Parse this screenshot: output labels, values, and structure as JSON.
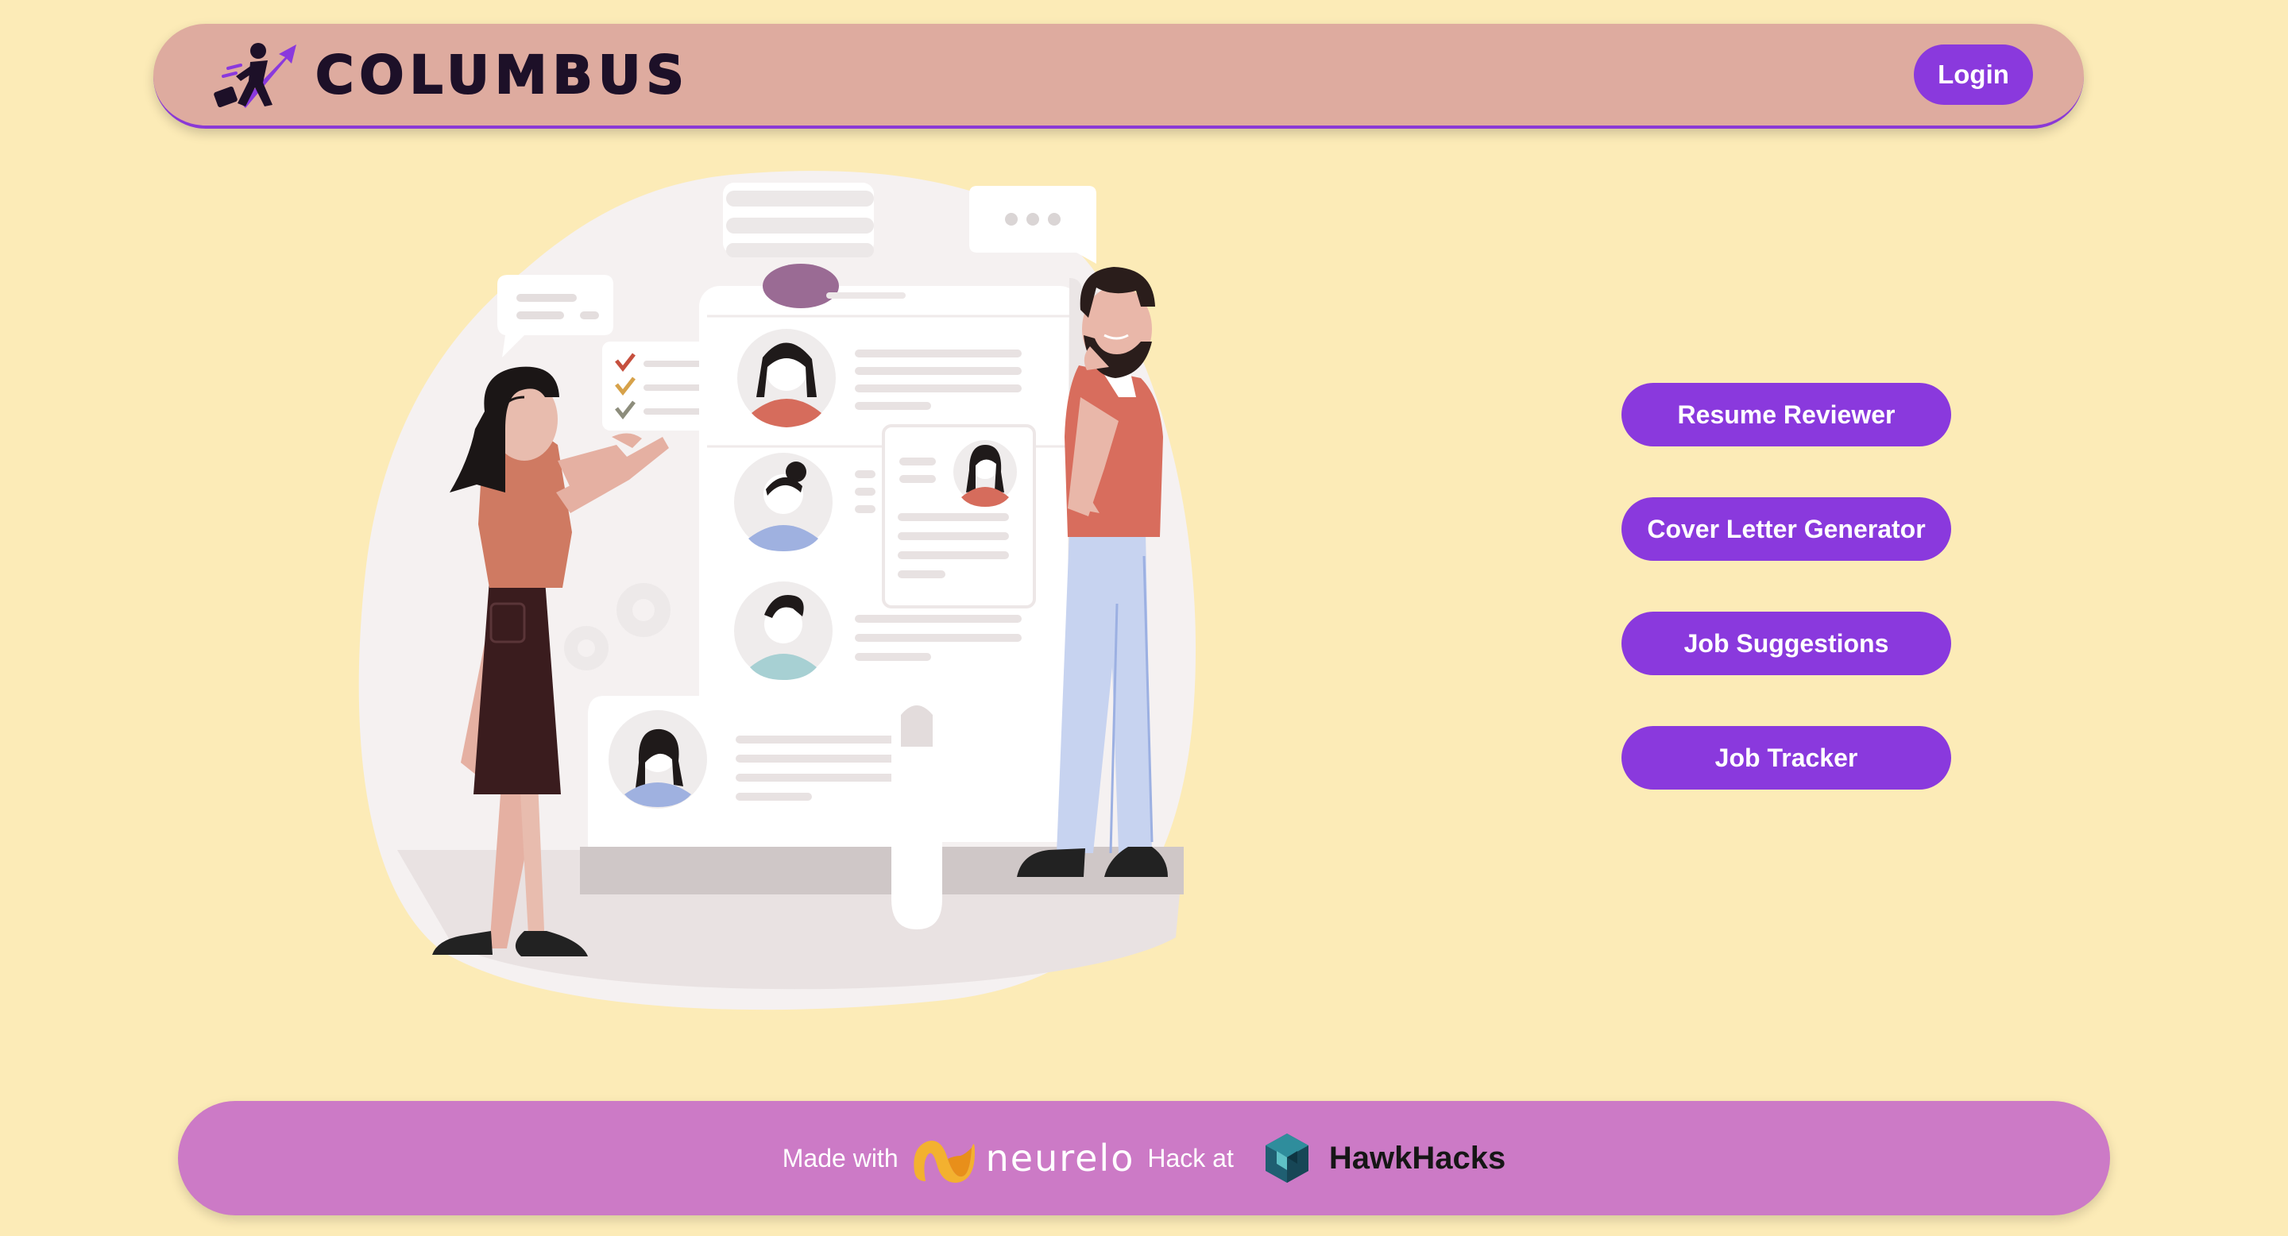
{
  "header": {
    "brand_name": "COLUMBUS",
    "login_label": "Login"
  },
  "hero": {
    "illustration": "recruiting-illustration"
  },
  "actions": [
    {
      "label": "Resume Reviewer"
    },
    {
      "label": "Cover Letter Generator"
    },
    {
      "label": "Job Suggestions"
    },
    {
      "label": "Job Tracker"
    }
  ],
  "footer": {
    "made_with": "Made with",
    "neurelo_name": "neurelo",
    "hack_at": "Hack at",
    "hawkhacks_name": "HawkHacks"
  },
  "colors": {
    "background": "#fcebb7",
    "header": "#deab9f",
    "accent": "#8a39dd",
    "footer": "#cc7ac6"
  }
}
